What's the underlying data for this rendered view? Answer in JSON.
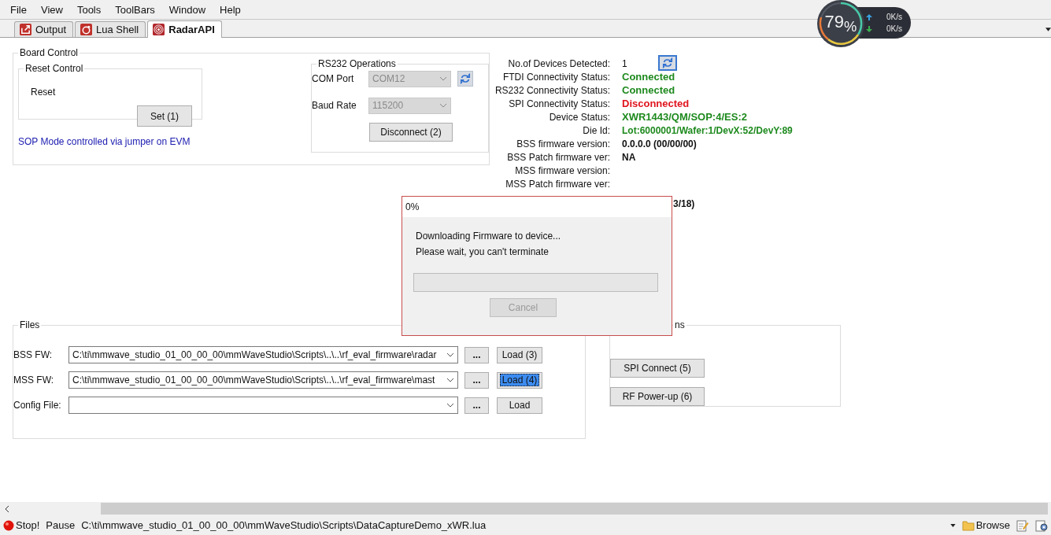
{
  "menu": [
    "File",
    "View",
    "Tools",
    "ToolBars",
    "Window",
    "Help"
  ],
  "tabs": [
    {
      "label": "Output",
      "kind": "output",
      "selected": false
    },
    {
      "label": "Lua Shell",
      "kind": "lua",
      "selected": false
    },
    {
      "label": "RadarAPI",
      "kind": "radar",
      "selected": true
    }
  ],
  "speed_widget": {
    "percent": "79$_{%}$",
    "upload": "0K/s",
    "download": "0K/s"
  },
  "board_control": {
    "title": "Board Control",
    "reset_control": {
      "title": "Reset Control",
      "label": "Reset",
      "button": "Set (1)"
    },
    "note": "SOP Mode controlled via jumper on EVM",
    "rs232": {
      "title": "RS232 Operations",
      "fields": [
        {
          "label": "COM Port",
          "value": "COM12",
          "disabled": true,
          "refresh": true
        },
        {
          "label": "Baud Rate",
          "value": "115200",
          "disabled": true,
          "refresh": false
        }
      ],
      "button": "Disconnect (2)"
    }
  },
  "device_info": {
    "rows": [
      {
        "label": "No.of Devices Detected:",
        "value": "1",
        "kind": "plain",
        "refresh": true
      },
      {
        "label": "FTDI Connectivity Status:",
        "value": "Connected",
        "kind": "ok"
      },
      {
        "label": "RS232 Connectivity Status:",
        "value": "Connected",
        "kind": "ok"
      },
      {
        "label": "SPI Connectivity Status:",
        "value": "Disconnected",
        "kind": "error"
      },
      {
        "label": "Device Status:",
        "value": "XWR1443/QM/SOP:4/ES:2",
        "kind": "ok"
      },
      {
        "label": "Die Id:",
        "value": "Lot:6000001/Wafer:1/DevX:52/DevY:89",
        "kind": "ok-small"
      },
      {
        "label": "BSS firmware version:",
        "value": "0.0.0.0 (00/00/00)",
        "kind": "bold"
      },
      {
        "label": "BSS Patch firmware ver:",
        "value": "NA",
        "kind": "bold"
      },
      {
        "label": "MSS firmware version:",
        "kind": "plain"
      },
      {
        "label": "MSS Patch firmware ver:",
        "kind": "plain"
      },
      {
        "value": "3/18)",
        "kind": "bold"
      }
    ]
  },
  "files": {
    "title": "Files",
    "rows": [
      {
        "label": "BSS FW:",
        "value": "C:\\ti\\mmwave_studio_01_00_00_00\\mmWaveStudio\\Scripts\\..\\..\\rf_eval_firmware\\radar",
        "browse": "...",
        "button": "Load (3)",
        "selected": false
      },
      {
        "label": "MSS FW:",
        "value": "C:\\ti\\mmwave_studio_01_00_00_00\\mmWaveStudio\\Scripts\\..\\..\\rf_eval_firmware\\mast",
        "browse": "...",
        "button": "Load (4)",
        "selected": true
      },
      {
        "label": "Config File:",
        "browse": "...",
        "button": "Load",
        "selected": false
      }
    ]
  },
  "operations": {
    "title": "ns",
    "buttons": [
      "SPI Connect (5)",
      "RF Power-up (6)"
    ]
  },
  "dialog": {
    "title": "0%",
    "lines": [
      "Downloading Firmware to device...",
      "Please wait, you can't terminate"
    ],
    "progress": {
      "level": 0
    },
    "button": {
      "label": "Cancel",
      "disabled": true
    }
  },
  "status_bar": {
    "stop": "Stop!",
    "pause": "Pause",
    "script_path": "C:\\ti\\mmwave_studio_01_00_00_00\\mmWaveStudio\\Scripts\\DataCaptureDemo_xWR.lua",
    "browse": "Browse"
  }
}
